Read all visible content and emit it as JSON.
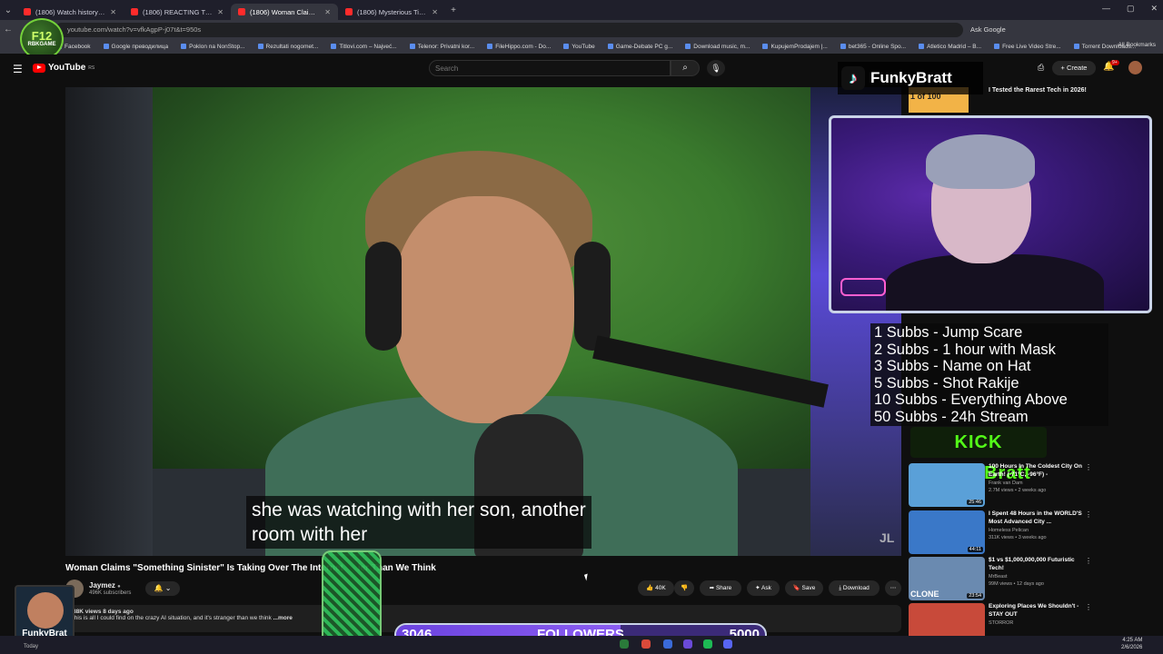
{
  "browser": {
    "tabs": [
      {
        "label": "(1806) Watch history - YouTube",
        "active": false
      },
      {
        "label": "(1806) REACTING TO UNEXPLA",
        "active": false
      },
      {
        "label": "(1806) Woman Claims \"Som",
        "active": true
      },
      {
        "label": "(1806) Mysterious TikToks They",
        "active": false
      }
    ],
    "new_tab": "+",
    "url": "youtube.com/watch?v=vfkAgpP-j07t&t=950s",
    "ask_google": "Ask Google",
    "bookmarks": [
      "Facebook",
      "Google преводилица",
      "Poklon na NonStop...",
      "Rezultati nogomet...",
      "Titlovi.com – Najveć...",
      "Telenor: Privatni kor...",
      "FileHippo.com - Do...",
      "YouTube",
      "Game-Debate PC g...",
      "Download music, m...",
      "KupujemProdajem |...",
      "bet365 - Online Spo...",
      "Atletico Madrid – B...",
      "Free Live Video Stre...",
      "Torrent Downloads..."
    ],
    "all_bookmarks": "All Bookmarks"
  },
  "logo_overlay": {
    "line1": "F12",
    "line2": "RBKGAME"
  },
  "youtube": {
    "logo_text": "YouTube",
    "logo_region": "RS",
    "search_placeholder": "Search",
    "create_label": "Create",
    "notif_count": "9+"
  },
  "video": {
    "caption_line1": "she was watching with her son, another",
    "caption_line2": "room with her",
    "watermark": "JL",
    "title": "Woman Claims \"Something Sinister\" Is Taking Over The Internet",
    "title_tail": "ier Than We Think",
    "channel": "Jaymez",
    "subscribers": "496K subscribers",
    "actions": {
      "likes": "40K",
      "share": "Share",
      "ask": "Ask",
      "save": "Save",
      "download": "Download"
    },
    "desc_views": "88K views  8 days ago",
    "desc_text": "this is all I could find on the crazy AI situation, and  it's stranger than we think",
    "desc_more": "...more"
  },
  "stream": {
    "tiktok_name": "FunkyBratt",
    "subgoals": [
      "1 Subbs - Jump Scare",
      "2 Subbs - 1 hour with Mask",
      "3 Subbs - Name on Hat",
      "5 Subbs - Shot Rakije",
      "10 Subbs - Everything Above",
      "50 Subbs - 24h Stream"
    ],
    "kick_label": "KICK FunkyBratt",
    "webcam_name": "FunkyBrat",
    "followers_current": "3046",
    "followers_label": "FOLLOWERS",
    "followers_goal": "5000",
    "followers_progress": 0.609
  },
  "recommendations": [
    {
      "title": "I Tested the Rarest Tech in 2026!",
      "thumb_text": "1 of 100",
      "thumb_color": "#f2b347"
    },
    {
      "title": "100 Hours In The Coldest City On Earth! (-71°C, -96°F) -",
      "channel": "Frank van Dam",
      "meta": "2.7M views • 2 weeks ago",
      "duration": "25:46",
      "thumb_color": "#5aa0d8"
    },
    {
      "title": "I Spent 48 Hours in the WORLD'S Most Advanced City ...",
      "channel": "Homeless Pelican",
      "meta": "311K views • 3 weeks ago",
      "duration": "44:11",
      "thumb_color": "#3a78c8"
    },
    {
      "title": "$1 vs $1,000,000,000 Futuristic Tech!",
      "channel": "MrBeast",
      "meta": "99M views • 12 days ago",
      "duration": "23:54",
      "thumb_text": "CLONE",
      "thumb_color": "#6a8ab0"
    },
    {
      "title": "Exploring Places We Shouldn't - STAY OUT",
      "channel": "STORROR",
      "meta": "",
      "thumb_color": "#c84a3a"
    }
  ],
  "taskbar": {
    "today": "Today",
    "time": "4:25 AM",
    "date": "2/6/2026"
  }
}
